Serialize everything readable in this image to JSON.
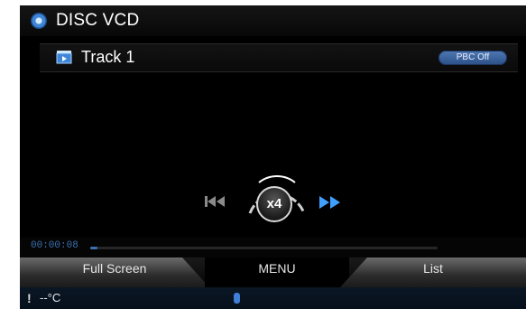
{
  "header": {
    "title": "DISC VCD",
    "icon": "disc-icon"
  },
  "track": {
    "label": "Track 1",
    "icon": "video-track-icon",
    "pbc_label": "PBC Off"
  },
  "controls": {
    "speed_label": "x4",
    "prev_icon": "rewind-icon",
    "next_icon": "fast-forward-icon"
  },
  "progress": {
    "time": "00:00:08",
    "fraction": 0.02
  },
  "menu": {
    "left_label": "Full Screen",
    "center_label": "MENU",
    "right_label": "List"
  },
  "status": {
    "temperature": "--°C",
    "warning_icon": "warning-icon",
    "bt_icon": "bluetooth-icon"
  },
  "colors": {
    "accent": "#3b6fb0",
    "pbc_button": "#3f6aa6",
    "background": "#000000"
  }
}
